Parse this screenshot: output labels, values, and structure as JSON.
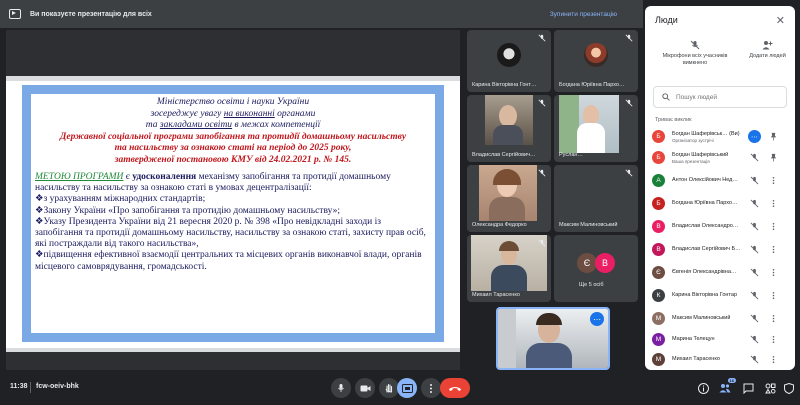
{
  "banner": {
    "text": "Ви показуєте презентацію для всіх",
    "stop_label": "Зупинити презентацію"
  },
  "slide": {
    "line1": "Міністерство освіти і науки України",
    "line2a": "зосереджує увагу ",
    "line2b": "на виконанні",
    "line2c": " органами",
    "line3a": "та ",
    "line3b": "закладами освіти",
    "line3c": " в межах компетенції",
    "red1": "Державної соціальної програми запобігання та протидії домашньому насильству",
    "red2": "та насильству за ознакою статі на період до 2025 року,",
    "red3": "затвердженої постановою КМУ від 24.02.2021 р. № 145.",
    "para_label": "МЕТОЮ ПРОГРАМИ",
    "para_mid": " є ",
    "para_bold": "удосконалення",
    "para_rest": " механізму запобігання та протидії домашньому насильству та насильству за ознакою статі в умовах децентралізації:",
    "bullet1": "❖з урахуванням міжнародних стандартів;",
    "bullet2": "❖Закону України «Про запобігання та протидію домашньому насильству»;",
    "bullet3": "❖Указу Президента України від 21 вересня 2020 р. № 398 «Про невідкладні заходи із запобігання та протидії домашньому насильству, насильству за ознакою статі, захисту прав осіб, які постраждали від такого насильства»,",
    "bullet4": "❖підвищення ефективної взаємодії центральних та місцевих органів виконавчої влади, органів місцевого самоврядування, громадськості."
  },
  "tiles": {
    "t1": "Карина Вікторівна Гонт…",
    "t2": "Богдана Юріївна Пархо…",
    "t3": "Владислав Сергійович…",
    "t4": "Руслан…",
    "t5": "Олександра Федорко",
    "t6": "Максим Малиновський",
    "t7": "Михаил Тарасенко",
    "more_label": "Ще 5 осіб",
    "more_initial1": "Є",
    "more_initial2": "В"
  },
  "bottom": {
    "time": "11:38",
    "code": "fcw-oeiv-bhk",
    "people_count": "16"
  },
  "panel": {
    "title": "Люди",
    "mute_all": "Мікрофони всіх учасників вимкнено",
    "add_people": "Додати людей",
    "search_placeholder": "Пошук людей",
    "section": "Триває виклик",
    "people": [
      {
        "initial": "Б",
        "name": "Богдан Шаферівськ…  (Ви)",
        "sub": "Організатор зустрічі",
        "color": "#e8453c"
      },
      {
        "initial": "Б",
        "name": "Богдан Шаферівський",
        "sub": "Ваша презентація",
        "color": "#e8453c"
      },
      {
        "initial": "А",
        "name": "Антон Олексійович Нед…",
        "sub": "",
        "color": "#188038"
      },
      {
        "initial": "Б",
        "name": "Богдана Юріївна Пархо…",
        "sub": "",
        "color": "#c5221f"
      },
      {
        "initial": "В",
        "name": "Владислав Олександро…",
        "sub": "",
        "color": "#e91e63"
      },
      {
        "initial": "В",
        "name": "Владислав Сергійович Б…",
        "sub": "",
        "color": "#c2185b"
      },
      {
        "initial": "Є",
        "name": "Євгенія Олександрівна…",
        "sub": "",
        "color": "#6d4c41"
      },
      {
        "initial": "К",
        "name": "Карина Вікторівна Гонтар",
        "sub": "",
        "color": "#3c4043"
      },
      {
        "initial": "М",
        "name": "Максим Малиновський",
        "sub": "",
        "color": "#8d6e63"
      },
      {
        "initial": "М",
        "name": "Марина Телецун",
        "sub": "",
        "color": "#7b1fa2"
      },
      {
        "initial": "М",
        "name": "Михаил Тарасенко",
        "sub": "",
        "color": "#5d4037"
      }
    ]
  }
}
